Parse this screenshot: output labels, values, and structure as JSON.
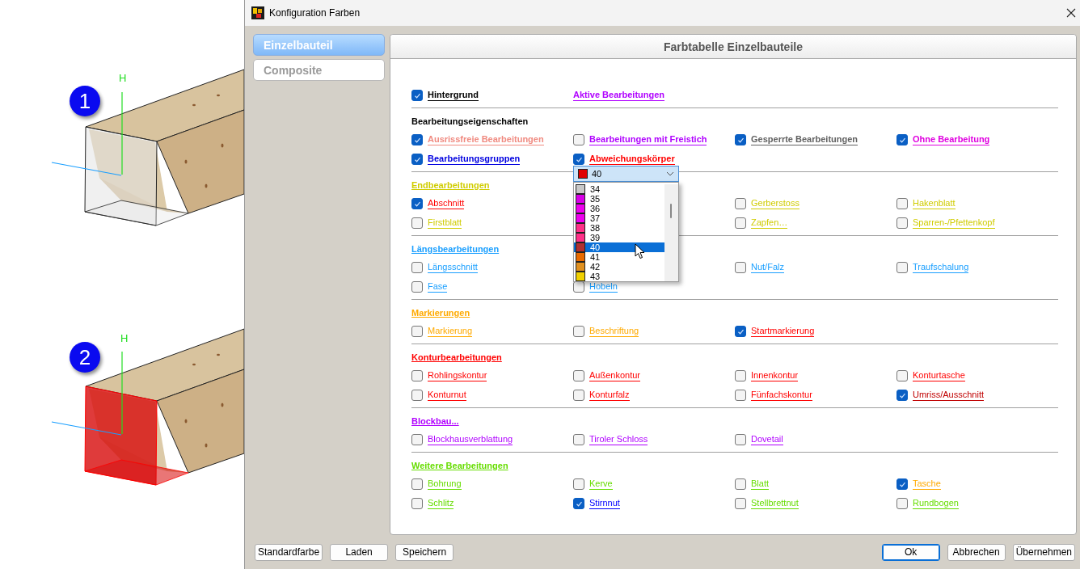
{
  "scene": {
    "markers": [
      {
        "number": "1",
        "axis_label": "H",
        "highlighted": false
      },
      {
        "number": "2",
        "axis_label": "H",
        "highlighted": true
      }
    ]
  },
  "window": {
    "title": "Konfiguration Farben"
  },
  "sidebar": {
    "items": [
      {
        "label": "Einzelbauteil",
        "selected": true
      },
      {
        "label": "Composite",
        "selected": false
      }
    ]
  },
  "panel": {
    "title": "Farbtabelle Einzelbauteile",
    "sections": [
      {
        "kind": "properties",
        "rows": [
          [
            {
              "kind": "checkbox",
              "label": "Hintergrund",
              "checked": true,
              "color": "#000000"
            },
            {
              "kind": "link",
              "label": "Aktive Bearbeitungen",
              "color": "#b000ff"
            }
          ]
        ]
      },
      {
        "kind": "properties",
        "heading": "Bearbeitungseigenschaften",
        "color": "#000000",
        "rows": [
          [
            {
              "kind": "checkbox",
              "label": "Ausrissfreie Bearbeitungen",
              "checked": true,
              "color": "#f08a80"
            },
            {
              "kind": "checkbox",
              "label": "Bearbeitungen mit Freistich",
              "checked": false,
              "color": "#b000ff"
            },
            {
              "kind": "checkbox",
              "label": "Gesperrte Bearbeitungen",
              "checked": true,
              "color": "#606060"
            },
            {
              "kind": "checkbox",
              "label": "Ohne Bearbeitung",
              "checked": true,
              "color": "#e000e0"
            }
          ],
          [
            {
              "kind": "checkbox",
              "label": "Bearbeitungsgruppen",
              "checked": true,
              "color": "#0000e0"
            },
            {
              "kind": "checkbox",
              "label": "Abweichungskörper",
              "checked": true,
              "color": "#ff0000",
              "dropdown": {
                "value": "40",
                "color": "#e00000",
                "options": [
                  {
                    "label": "34",
                    "color": "#c8c8c8",
                    "selected": false
                  },
                  {
                    "label": "35",
                    "color": "#d800e8",
                    "selected": false
                  },
                  {
                    "label": "36",
                    "color": "#ee00ee",
                    "selected": false
                  },
                  {
                    "label": "37",
                    "color": "#ee00ee",
                    "selected": false
                  },
                  {
                    "label": "38",
                    "color": "#ff3088",
                    "selected": false
                  },
                  {
                    "label": "39",
                    "color": "#ff3088",
                    "selected": false
                  },
                  {
                    "label": "40",
                    "color": "#b03030",
                    "selected": true
                  },
                  {
                    "label": "41",
                    "color": "#e86a00",
                    "selected": false
                  },
                  {
                    "label": "42",
                    "color": "#e09020",
                    "selected": false
                  },
                  {
                    "label": "43",
                    "color": "#f0d000",
                    "selected": false
                  }
                ]
              }
            }
          ]
        ]
      },
      {
        "kind": "group",
        "heading": "Endbearbeitungen",
        "color": "#d0cc00",
        "rows": [
          [
            {
              "kind": "checkbox",
              "label": "Abschnitt",
              "checked": true,
              "color": "#ff0000"
            },
            null,
            {
              "kind": "checkbox",
              "label": "Gerberstoss",
              "checked": false,
              "color": "#d0cc00"
            },
            {
              "kind": "checkbox",
              "label": "Hakenblatt",
              "checked": false,
              "color": "#d0cc00"
            }
          ],
          [
            {
              "kind": "checkbox",
              "label": "Firstblatt",
              "checked": false,
              "color": "#d0cc00"
            },
            null,
            {
              "kind": "checkbox",
              "label": "Zapfen…",
              "checked": false,
              "color": "#d0cc00"
            },
            {
              "kind": "checkbox",
              "label": "Sparren-/Pfettenkopf",
              "checked": false,
              "color": "#d0cc00"
            }
          ]
        ]
      },
      {
        "kind": "group",
        "heading": "Längsbearbeitungen",
        "color": "#1a9fff",
        "rows": [
          [
            {
              "kind": "checkbox",
              "label": "Längsschnitt",
              "checked": false,
              "color": "#1a9fff"
            },
            null,
            {
              "kind": "checkbox",
              "label": "Nut/Falz",
              "checked": false,
              "color": "#1a9fff"
            },
            {
              "kind": "checkbox",
              "label": "Traufschalung",
              "checked": false,
              "color": "#1a9fff"
            }
          ],
          [
            {
              "kind": "checkbox",
              "label": "Fase",
              "checked": false,
              "color": "#1a9fff"
            },
            {
              "kind": "checkbox",
              "label": "Hobeln",
              "checked": false,
              "color": "#1a9fff"
            }
          ]
        ]
      },
      {
        "kind": "group",
        "heading": "Markierungen",
        "color": "#ffaa00",
        "rows": [
          [
            {
              "kind": "checkbox",
              "label": "Markierung",
              "checked": false,
              "color": "#ffaa00"
            },
            {
              "kind": "checkbox",
              "label": "Beschriftung",
              "checked": false,
              "color": "#ffaa00"
            },
            {
              "kind": "checkbox",
              "label": "Startmarkierung",
              "checked": true,
              "color": "#ff0000"
            }
          ]
        ]
      },
      {
        "kind": "group",
        "heading": "Konturbearbeitungen",
        "color": "#ff0000",
        "rows": [
          [
            {
              "kind": "checkbox",
              "label": "Rohlingskontur",
              "checked": false,
              "color": "#ff0000"
            },
            {
              "kind": "checkbox",
              "label": "Außenkontur",
              "checked": false,
              "color": "#ff0000"
            },
            {
              "kind": "checkbox",
              "label": "Innenkontur",
              "checked": false,
              "color": "#ff0000"
            },
            {
              "kind": "checkbox",
              "label": "Konturtasche",
              "checked": false,
              "color": "#ff0000"
            }
          ],
          [
            {
              "kind": "checkbox",
              "label": "Konturnut",
              "checked": false,
              "color": "#ff0000"
            },
            {
              "kind": "checkbox",
              "label": "Konturfalz",
              "checked": false,
              "color": "#ff0000"
            },
            {
              "kind": "checkbox",
              "label": "Fünfachskontur",
              "checked": false,
              "color": "#ff0000"
            },
            {
              "kind": "checkbox",
              "label": "Umriss/Ausschnitt",
              "checked": true,
              "color": "#c00000"
            }
          ]
        ]
      },
      {
        "kind": "group",
        "heading": "Blockbau...",
        "color": "#b000ff",
        "rows": [
          [
            {
              "kind": "checkbox",
              "label": "Blockhausverblattung",
              "checked": false,
              "color": "#b000ff"
            },
            {
              "kind": "checkbox",
              "label": "Tiroler Schloss",
              "checked": false,
              "color": "#b000ff"
            },
            {
              "kind": "checkbox",
              "label": "Dovetail",
              "checked": false,
              "color": "#b000ff"
            }
          ]
        ]
      },
      {
        "kind": "group",
        "heading": "Weitere Bearbeitungen",
        "color": "#66dd00",
        "rows": [
          [
            {
              "kind": "checkbox",
              "label": "Bohrung",
              "checked": false,
              "color": "#66dd00"
            },
            {
              "kind": "checkbox",
              "label": "Kerve",
              "checked": false,
              "color": "#66dd00"
            },
            {
              "kind": "checkbox",
              "label": "Blatt",
              "checked": false,
              "color": "#66dd00"
            },
            {
              "kind": "checkbox",
              "label": "Tasche",
              "checked": true,
              "color": "#ffaa00"
            }
          ],
          [
            {
              "kind": "checkbox",
              "label": "Schlitz",
              "checked": false,
              "color": "#66dd00"
            },
            {
              "kind": "checkbox",
              "label": "Stirnnut",
              "checked": true,
              "color": "#0000ff"
            },
            {
              "kind": "checkbox",
              "label": "Stellbrettnut",
              "checked": false,
              "color": "#66dd00"
            },
            {
              "kind": "checkbox",
              "label": "Rundbogen",
              "checked": false,
              "color": "#66dd00"
            }
          ]
        ]
      }
    ]
  },
  "footer": {
    "left_buttons": [
      {
        "label": "Standardfarbe",
        "default": false
      },
      {
        "label": "Laden",
        "default": false
      },
      {
        "label": "Speichern",
        "default": false
      }
    ],
    "right_buttons": [
      {
        "label": "Ok",
        "default": true
      },
      {
        "label": "Abbrechen",
        "default": false
      },
      {
        "label": "Übernehmen",
        "default": false
      }
    ]
  }
}
